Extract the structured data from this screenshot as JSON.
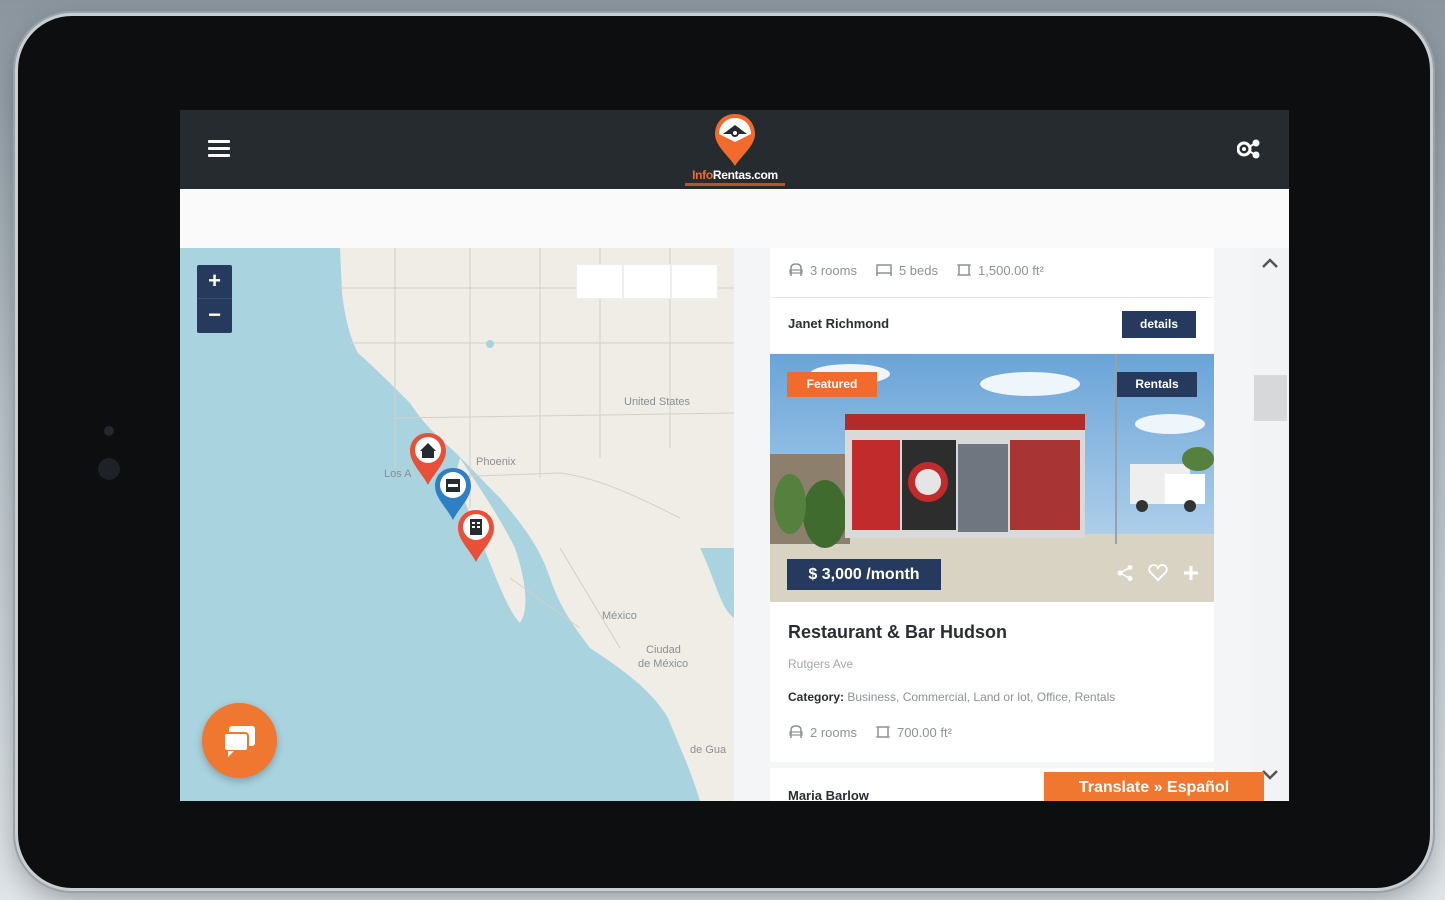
{
  "header": {
    "logo_text_prefix": "Info",
    "logo_text_suffix": "Rentas.com",
    "menu_icon": "hamburger-icon",
    "share_icon": "share-settings-icon"
  },
  "map": {
    "zoom_in": "+",
    "zoom_out": "−",
    "labels": {
      "united_states": "United States",
      "phoenix": "Phoenix",
      "los_angeles": "Los A",
      "mexico": "México",
      "ciudad": "Ciudad",
      "de_mexico": "de México",
      "de_gua": "de Gua"
    },
    "pins": [
      {
        "icon": "house-icon",
        "color": "#e8503a"
      },
      {
        "icon": "store-icon",
        "color": "#2f7fc4"
      },
      {
        "icon": "building-icon",
        "color": "#e8503a"
      }
    ],
    "chat_icon": "chat-bubbles-icon"
  },
  "listing_prev": {
    "rooms": "3 rooms",
    "beds": "5 beds",
    "area": "1,500.00 ft²",
    "agent": "Janet Richmond",
    "details": "details"
  },
  "listing": {
    "badge_featured": "Featured",
    "badge_type": "Rentals",
    "price": "$ 3,000 /month",
    "title": "Restaurant & Bar Hudson",
    "address": "Rutgers Ave",
    "category_label": "Category:",
    "category_value": "Business, Commercial, Land or lot, Office, Rentals",
    "rooms": "2 rooms",
    "area": "700.00 ft²",
    "agent": "Maria Barlow"
  },
  "translate": "Translate » Español",
  "colors": {
    "accent_orange": "#f26b2c",
    "navy": "#263a5e",
    "header_dark": "#262b30"
  }
}
